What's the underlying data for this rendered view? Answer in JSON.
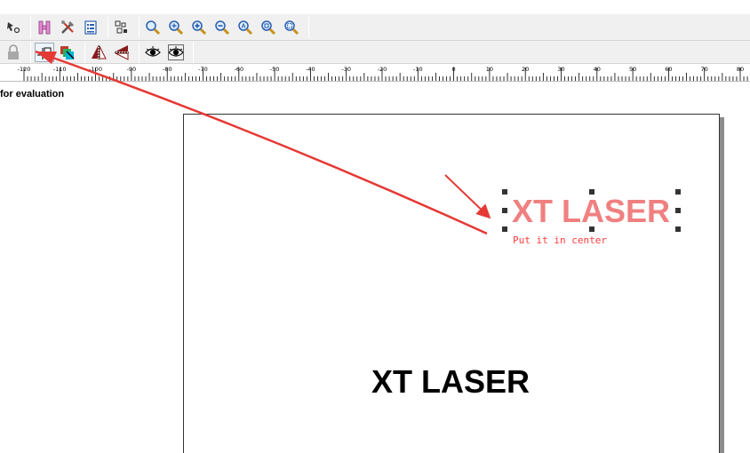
{
  "toolbar_row1": {
    "icons": [
      "node-edit-icon",
      "h-tool-icon",
      "tools-icon",
      "list-icon",
      "shapes-icon",
      "zoom-icon",
      "zoom-in-icon",
      "zoom-in-icon-2",
      "zoom-out-icon",
      "zoom-all-icon",
      "zoom-page-icon",
      "zoom-selection-icon"
    ]
  },
  "toolbar_row2": {
    "icons": [
      "lock-icon",
      "center-align-icon",
      "layer-color-icon",
      "mirror-horizontal-icon",
      "mirror-vertical-icon",
      "eye-icon",
      "eye-icon-2"
    ]
  },
  "ruler": {
    "labels": [
      "-120",
      "-110",
      "-100",
      "-90",
      "-80",
      "-70",
      "-60",
      "-50",
      "-40",
      "-30",
      "-20",
      "-10",
      "0",
      "10",
      "20",
      "30",
      "40",
      "50",
      "60",
      "70",
      "80"
    ]
  },
  "canvas": {
    "evaluation_text": "for evaluation",
    "selected_text": "XT LASER",
    "annotation": "Put it in center",
    "main_text": "XT LASER"
  },
  "colors": {
    "selected_text": "#f08080",
    "annotation": "#ff3b3b",
    "arrow": "#e53935"
  }
}
